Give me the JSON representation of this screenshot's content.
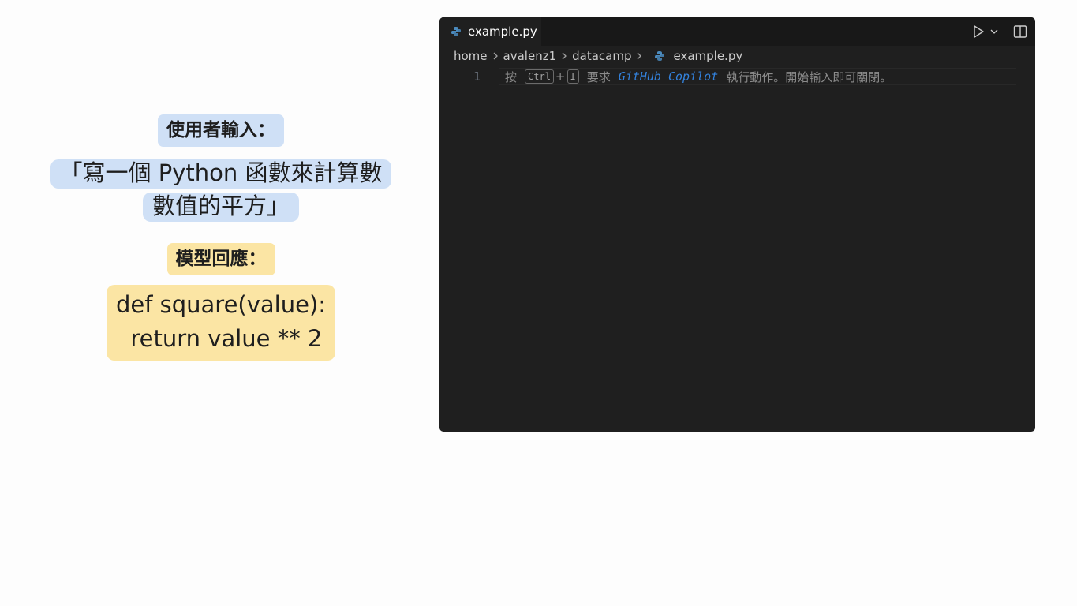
{
  "left_panel": {
    "user_input_label": "使用者輸入：",
    "user_input_line1": "「寫一個 Python 函數來計算數",
    "user_input_line2": "數值的平方」",
    "model_response_label": "模型回應：",
    "code_line1": "def square(value):",
    "code_line2": "  return value ** 2"
  },
  "editor": {
    "tab": {
      "filename": "example.py",
      "icon": "python-icon",
      "unsaved": true
    },
    "actions": {
      "run_icon": "run-icon",
      "dropdown_icon": "chevron-down-icon",
      "split_icon": "split-editor-icon"
    },
    "breadcrumb": [
      "home",
      "avalenz1",
      "datacamp",
      "example.py"
    ],
    "line_number": "1",
    "hint": {
      "prefix": "按",
      "key1": "Ctrl",
      "plus": "+",
      "key2": "I",
      "middle": "要求",
      "product": "GitHub Copilot",
      "suffix": "執行動作。開始輸入即可關閉。"
    }
  },
  "colors": {
    "blue_highlight": "#cfe0f6",
    "yellow_highlight": "#fbe5a4",
    "editor_bg": "#1f1f1f",
    "copilot_link": "#3794ff"
  }
}
